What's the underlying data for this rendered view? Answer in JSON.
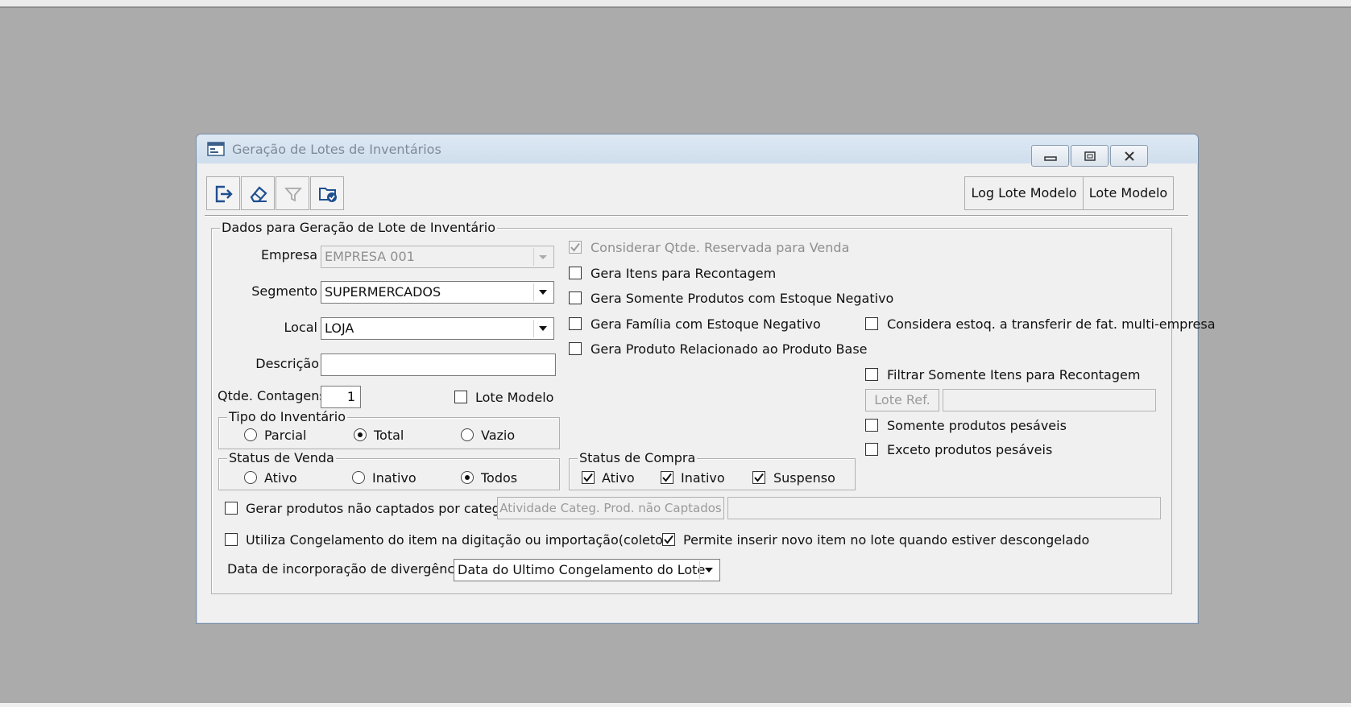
{
  "window": {
    "title": "Geração de Lotes de Inventários"
  },
  "toolbar": {
    "exit_icon": "exit-icon",
    "clear_icon": "eraser-icon",
    "filter_icon": "filter-icon",
    "save_icon": "folder-check-icon",
    "log_lote_modelo": "Log Lote Modelo",
    "lote_modelo": "Lote Modelo"
  },
  "group_main": {
    "legend": "Dados para Geração de Lote de Inventário"
  },
  "fields": {
    "empresa_label": "Empresa",
    "empresa_value": "EMPRESA 001",
    "segmento_label": "Segmento",
    "segmento_value": "SUPERMERCADOS",
    "local_label": "Local",
    "local_value": "LOJA",
    "descricao_label": "Descrição",
    "descricao_value": "",
    "qtde_label": "Qtde. Contagens",
    "qtde_value": "1",
    "lote_modelo_label": "Lote Modelo",
    "lote_modelo_checked": false
  },
  "tipo_inventario": {
    "legend": "Tipo do Inventário",
    "options": [
      "Parcial",
      "Total",
      "Vazio"
    ],
    "selected": "Total"
  },
  "status_venda": {
    "legend": "Status de Venda",
    "options": [
      "Ativo",
      "Inativo",
      "Todos"
    ],
    "selected": "Todos"
  },
  "status_compra": {
    "legend": "Status de Compra",
    "items": [
      {
        "label": "Ativo",
        "checked": true
      },
      {
        "label": "Inativo",
        "checked": true
      },
      {
        "label": "Suspenso",
        "checked": true
      }
    ]
  },
  "options_middle": [
    {
      "label": "Considerar Qtde. Reservada para Venda",
      "checked": true,
      "disabled": true
    },
    {
      "label": "Gera Itens para Recontagem",
      "checked": false
    },
    {
      "label": "Gera Somente Produtos com Estoque Negativo",
      "checked": false
    },
    {
      "label": "Gera Família com Estoque Negativo",
      "checked": false
    },
    {
      "label": "Gera Produto Relacionado ao Produto Base",
      "checked": false
    }
  ],
  "options_right": {
    "considera_estoq": "Considera estoq. a transferir de fat. multi-empresa",
    "filtrar_recontagem": "Filtrar Somente Itens para Recontagem",
    "lote_ref_button": "Lote Ref.",
    "lote_ref_value": "",
    "somente_pesaveis": "Somente produtos pesáveis",
    "exceto_pesaveis": "Exceto produtos pesáveis"
  },
  "bottom": {
    "gerar_nao_captados": "Gerar produtos não captados por categoria",
    "atividade_button": "Atividade Categ. Prod. não Captados",
    "atividade_value": "",
    "utiliza_congelamento": "Utiliza Congelamento do item na digitação ou importação(coletor)",
    "utiliza_checked": false,
    "permite_inserir": "Permite inserir novo item no lote quando estiver descongelado",
    "permite_checked": true,
    "data_label": "Data de incorporação de divergências",
    "data_value": "Data do Ultimo Congelamento do Lote"
  }
}
